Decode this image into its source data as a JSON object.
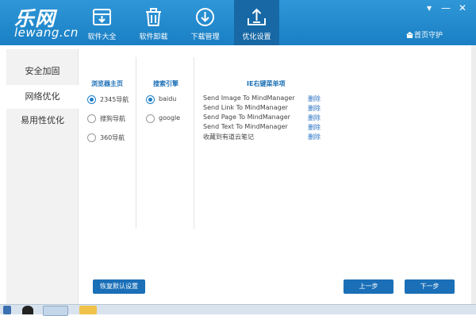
{
  "app": {
    "logo_cn": "乐网",
    "logo_en": "lewang.cn",
    "home_guard": "首页守护"
  },
  "nav": [
    {
      "label": "软件大全",
      "icon": "download-box-icon"
    },
    {
      "label": "软件卸载",
      "icon": "trash-icon"
    },
    {
      "label": "下载管理",
      "icon": "download-circle-icon"
    },
    {
      "label": "优化设置",
      "icon": "upload-tray-icon",
      "active": true
    }
  ],
  "window_controls": {
    "menu": "▾",
    "minimize": "—",
    "close": "✕"
  },
  "sidebar": {
    "items": [
      {
        "label": "安全加固"
      },
      {
        "label": "网络优化",
        "active": true
      },
      {
        "label": "易用性优化"
      }
    ]
  },
  "browser_home": {
    "heading": "浏览器主页",
    "options": [
      {
        "label": "2345导航",
        "checked": true
      },
      {
        "label": "搜狗导航",
        "checked": false
      },
      {
        "label": "360导航",
        "checked": false
      }
    ]
  },
  "search_engine": {
    "heading": "搜索引擎",
    "options": [
      {
        "label": "baidu",
        "checked": true
      },
      {
        "label": "google",
        "checked": false
      }
    ]
  },
  "context_menu": {
    "heading": "IE右键菜单项",
    "items": [
      {
        "name": "Send Image To MindManager",
        "action": "删除"
      },
      {
        "name": "Send Link To MindManager",
        "action": "删除"
      },
      {
        "name": "Send Page To MindManager",
        "action": "删除"
      },
      {
        "name": "Send Text To MindManager",
        "action": "删除"
      },
      {
        "name": "收藏到有道云笔记",
        "action": "删除"
      }
    ]
  },
  "buttons": {
    "restore_default": "恢复默认设置",
    "prev": "上一步",
    "next": "下一步"
  },
  "colors": {
    "accent": "#1b7fc9",
    "header": "#2f97d8",
    "link": "#2a73c4"
  }
}
